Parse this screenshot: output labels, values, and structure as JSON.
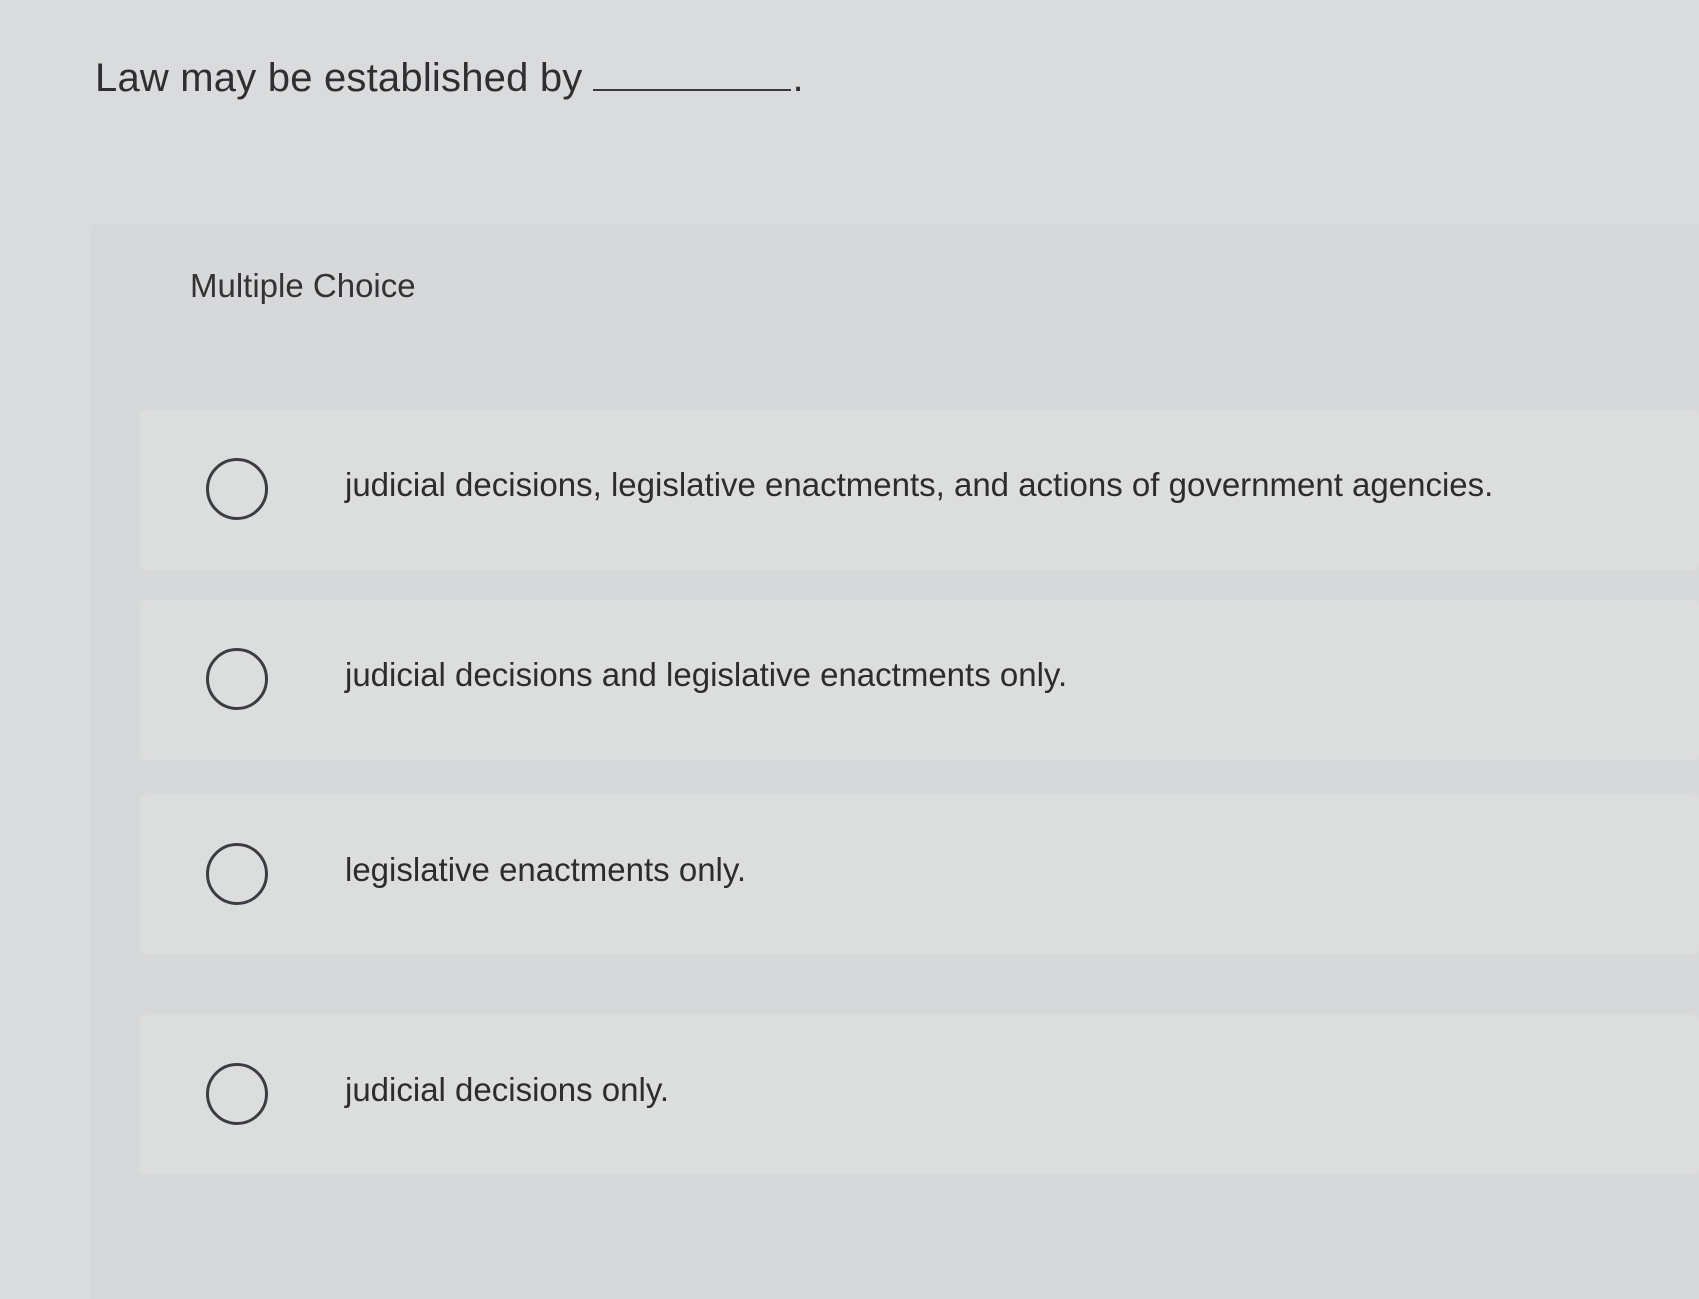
{
  "question": {
    "text": "Law may be established by",
    "period": "."
  },
  "multiple_choice_label": "Multiple Choice",
  "choices": [
    {
      "label": "judicial decisions, legislative enactments, and actions of government agencies.",
      "selected": false
    },
    {
      "label": "judicial decisions and legislative enactments only.",
      "selected": false
    },
    {
      "label": "legislative enactments only.",
      "selected": false
    },
    {
      "label": "judicial decisions only.",
      "selected": false
    }
  ]
}
